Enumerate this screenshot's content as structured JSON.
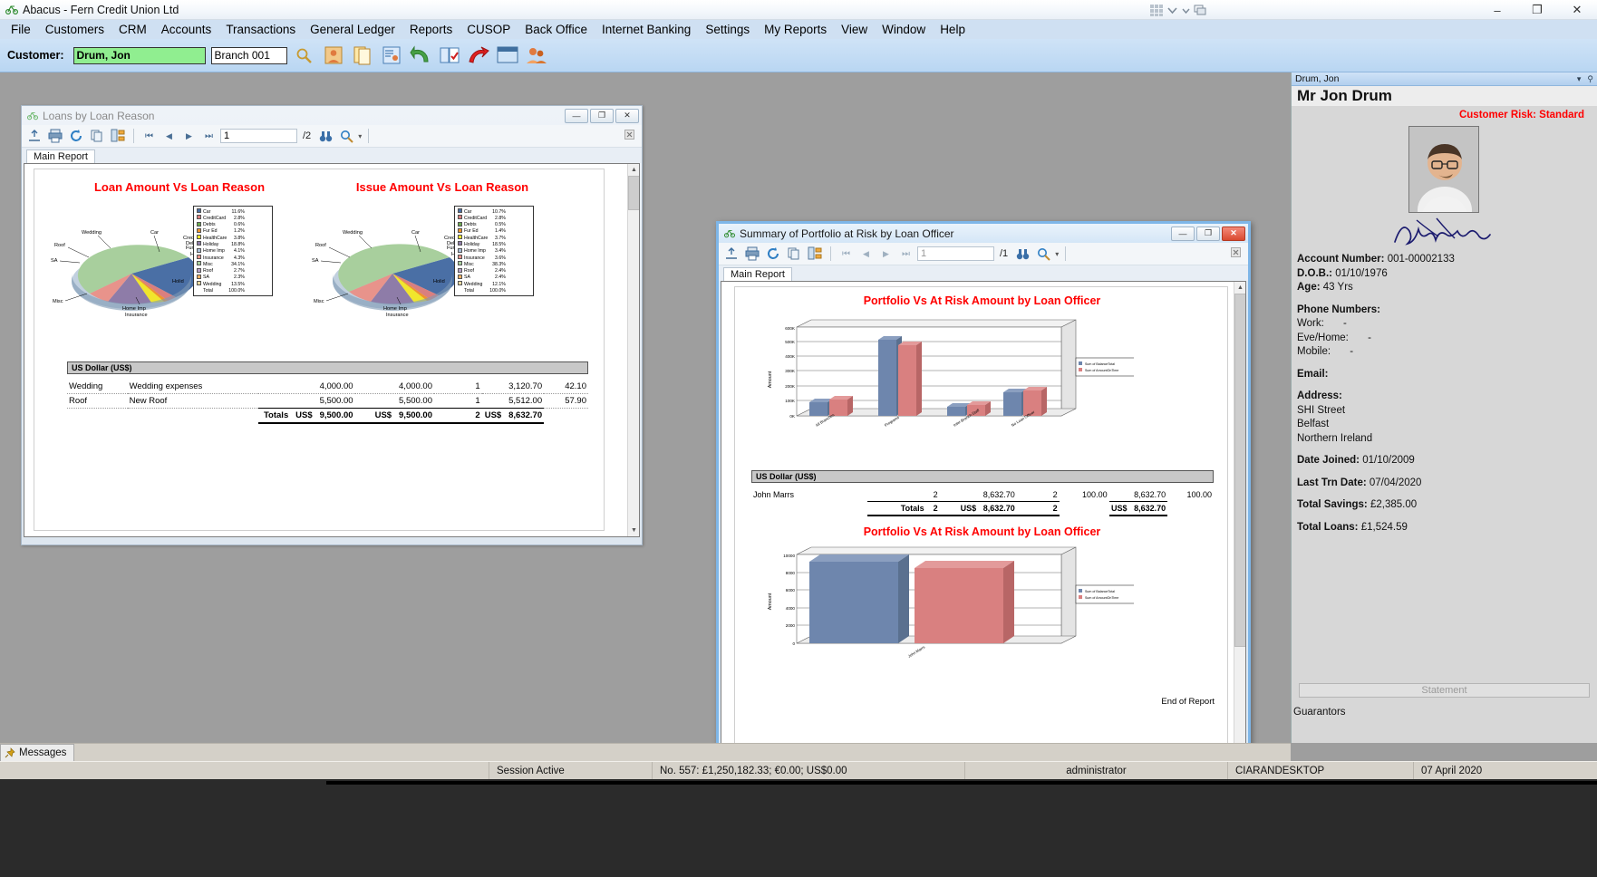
{
  "app": {
    "title": "Abacus - Fern Credit Union Ltd",
    "icon": "abacus-icon",
    "window_controls": {
      "minimize": "–",
      "maximize": "❐",
      "close": "✕"
    }
  },
  "menubar": {
    "items": [
      "File",
      "Customers",
      "CRM",
      "Accounts",
      "Transactions",
      "General Ledger",
      "Reports",
      "CUSOP",
      "Back Office",
      "Internet Banking",
      "Settings",
      "My Reports",
      "View",
      "Window",
      "Help"
    ]
  },
  "customer_toolbar": {
    "label": "Customer:",
    "customer_value": "Drum, Jon",
    "customer_placeholder": "Customer name",
    "branch_value": "Branch 001",
    "branch_placeholder": "Branch",
    "icons": [
      "search-icon",
      "customer-card-icon",
      "documents-icon",
      "customer-details-icon",
      "undo-arrow-icon",
      "book-check-icon",
      "red-arrow-icon",
      "window-icon",
      "people-icon"
    ]
  },
  "report_window_1": {
    "title": "Loans by Loan Reason",
    "icon": "abacus-icon",
    "active": false,
    "buttons": {
      "minimize": "—",
      "maximize": "❐",
      "close": "✕"
    },
    "toolbar": {
      "icons": [
        "export-icon",
        "print-icon",
        "refresh-icon",
        "copy-icon",
        "group-tree-icon"
      ],
      "nav": [
        "⏮",
        "◀",
        "▶",
        "⏭"
      ],
      "page_value": "1",
      "page_total": "/2",
      "find_icon": "binoculars-icon",
      "zoom_icon": "zoom-icon",
      "zoom_caret": "▾"
    },
    "tab": "Main Report",
    "chart_left_title": "Loan Amount Vs Loan Reason",
    "chart_right_title": "Issue Amount Vs Loan Reason",
    "group_bar": "US Dollar (US$)",
    "table": {
      "rows": [
        {
          "reason": "Wedding",
          "desc": "Wedding expenses",
          "amount": "4,000.00",
          "issue": "4,000.00",
          "count": "1",
          "balance": "3,120.70",
          "pct": "42.10"
        },
        {
          "reason": "Roof",
          "desc": "New Roof",
          "amount": "5,500.00",
          "issue": "5,500.00",
          "count": "1",
          "balance": "5,512.00",
          "pct": "57.90"
        }
      ],
      "totals_label": "Totals",
      "cur1": "US$",
      "total1": "9,500.00",
      "cur2": "US$",
      "total2": "9,500.00",
      "total_count": "2",
      "cur3": "US$",
      "total3": "8,632.70"
    }
  },
  "report_window_2": {
    "title": "Summary of Portfolio at Risk by Loan Officer",
    "icon": "abacus-icon",
    "active": true,
    "buttons": {
      "minimize": "—",
      "maximize": "❐",
      "close": "✕"
    },
    "toolbar": {
      "icons": [
        "export-icon",
        "print-icon",
        "refresh-icon",
        "copy-icon",
        "group-tree-icon"
      ],
      "nav": [
        "⏮",
        "◀",
        "▶",
        "⏭"
      ],
      "page_value": "1",
      "page_total": "/1",
      "find_icon": "binoculars-icon",
      "zoom_icon": "zoom-icon",
      "zoom_caret": "▾"
    },
    "tab": "Main Report",
    "chart_top_title": "Portfolio Vs At Risk Amount by Loan Officer",
    "chart_bottom_title": "Portfolio Vs At Risk Amount by Loan Officer",
    "group_bar": "US Dollar (US$)",
    "table": {
      "rows": [
        {
          "officer": "John Marrs",
          "count": "2",
          "amount": "8,632.70",
          "count2": "2",
          "pct": "100.00",
          "amount2": "8,632.70",
          "pct2": "100.00"
        }
      ],
      "totals_label": "Totals",
      "total_count": "2",
      "cur1": "US$",
      "total1": "8,632.70",
      "total_count2": "2",
      "cur2": "US$",
      "total2": "8,632.70"
    },
    "end_of_report": "End of Report"
  },
  "chart_data": [
    {
      "type": "pie",
      "title": "Loan Amount Vs Loan Reason",
      "legend_position": "right",
      "categories": [
        "Car",
        "CreditCard",
        "Debts",
        "Fur Ed",
        "HealthCare",
        "Holiday",
        "Home Imp",
        "Insurance",
        "Misc",
        "Roof",
        "SA",
        "Wedding"
      ],
      "values": [
        11.6,
        2.8,
        0.6,
        1.2,
        3.8,
        18.8,
        4.1,
        4.3,
        34.1,
        2.7,
        2.3,
        13.5
      ],
      "value_labels": [
        "11.6%",
        "2.8%",
        "0.6%",
        "1.2%",
        "3.8%",
        "18.8%",
        "4.1%",
        "4.3%",
        "34.1%",
        "2.7%",
        "2.3%",
        "13.5%"
      ],
      "total_label": "Total",
      "total_value": "100.0%",
      "colors": [
        "#4a6fa5",
        "#d97f7f",
        "#6aa84f",
        "#f0932b",
        "#f1e62c",
        "#8e7ca8",
        "#a9bed8",
        "#e8938b",
        "#a8cf9d",
        "#b7a0c9",
        "#f0b060",
        "#e8d8a0"
      ],
      "slice_callouts": [
        "Wedding",
        "Car",
        "CreditCard",
        "Fur Ed",
        "HealthCare",
        "Holiday",
        "Home Imp",
        "Insurance",
        "Misc",
        "SA",
        "Roof"
      ]
    },
    {
      "type": "pie",
      "title": "Issue Amount Vs Loan Reason",
      "legend_position": "right",
      "categories": [
        "Car",
        "CreditCard",
        "Debts",
        "Fur Ed",
        "HealthCare",
        "Holiday",
        "Home Imp",
        "Insurance",
        "Misc",
        "Roof",
        "SA",
        "Wedding"
      ],
      "values": [
        10.7,
        2.8,
        0.5,
        1.4,
        3.7,
        18.5,
        3.4,
        3.6,
        38.3,
        2.4,
        2.4,
        12.1
      ],
      "value_labels": [
        "10.7%",
        "2.8%",
        "0.5%",
        "1.4%",
        "3.7%",
        "18.5%",
        "3.4%",
        "3.6%",
        "38.3%",
        "2.4%",
        "2.4%",
        "12.1%"
      ],
      "total_label": "Total",
      "total_value": "100.0%",
      "colors": [
        "#4a6fa5",
        "#d97f7f",
        "#6aa84f",
        "#f0932b",
        "#f1e62c",
        "#8e7ca8",
        "#a9bed8",
        "#e8938b",
        "#a8cf9d",
        "#b7a0c9",
        "#f0b060",
        "#e8d8a0"
      ],
      "slice_callouts": [
        "Wedding",
        "Car",
        "CreditCard",
        "Fur Ed",
        "HealthCare",
        "Holiday",
        "Home Imp",
        "Insurance",
        "Misc",
        "SA",
        "Roof"
      ]
    },
    {
      "type": "bar",
      "title": "Portfolio Vs At Risk Amount by Loan Officer",
      "ylabel": "Amount",
      "xlabel": "",
      "categories": [
        "All Branches",
        "Programs",
        "Inter-Branch Staff",
        "No Loan Officer"
      ],
      "ytick_labels": [
        "0K",
        "100K",
        "200K",
        "300K",
        "400K",
        "500K",
        "600K"
      ],
      "ylim": [
        0,
        600000
      ],
      "series": [
        {
          "name": "Sum of BalanceTotal",
          "values": [
            90000,
            520000,
            60000,
            160000
          ],
          "color": "#6e86ad"
        },
        {
          "name": "Sum of AmountOnTime",
          "values": [
            105000,
            480000,
            75000,
            170000
          ],
          "color": "#d98080"
        }
      ],
      "legend_position": "right",
      "grid": true
    },
    {
      "type": "bar",
      "title": "Portfolio Vs At Risk Amount by Loan Officer",
      "ylabel": "Amount",
      "xlabel": "",
      "categories": [
        "John Marrs"
      ],
      "ytick_labels": [
        "0",
        "2000",
        "4000",
        "6000",
        "8000",
        "10000"
      ],
      "ylim": [
        0,
        10000
      ],
      "series": [
        {
          "name": "Sum of BalanceTotal",
          "values": [
            9500
          ],
          "color": "#6e86ad"
        },
        {
          "name": "Sum of AmountOnTime",
          "values": [
            8632
          ],
          "color": "#d98080"
        }
      ],
      "legend_position": "right",
      "grid": true
    }
  ],
  "sidebar": {
    "header_name": "Drum, Jon",
    "header_caret": "▾",
    "header_pin": "⚲",
    "display_name": "Mr Jon Drum",
    "risk": "Customer Risk: Standard",
    "photo": "customer-photo",
    "signature": "customer-signature",
    "account_number_label": "Account Number:",
    "account_number": "001-00002133",
    "dob_label": "D.O.B.:",
    "dob": "01/10/1976",
    "age_label": "Age:",
    "age": "43 Yrs",
    "phone_heading": "Phone Numbers:",
    "phone_work_label": "Work:",
    "phone_work": "-",
    "phone_eve_label": "Eve/Home:",
    "phone_eve": "-",
    "phone_mobile_label": "Mobile:",
    "phone_mobile": "-",
    "email_label": "Email:",
    "email": "",
    "address_label": "Address:",
    "address_lines": [
      "SHI Street",
      "Belfast",
      "Northern Ireland"
    ],
    "date_joined_label": "Date Joined:",
    "date_joined": "01/10/2009",
    "last_trn_label": "Last Trn Date:",
    "last_trn": "07/04/2020",
    "total_savings_label": "Total Savings:",
    "total_savings": "£2,385.00",
    "total_loans_label": "Total Loans:",
    "total_loans": "£1,524.59",
    "statement_button": "Statement",
    "guarantors": "Guarantors"
  },
  "messages_bar": {
    "tab": "Messages",
    "icon": "pin-icon"
  },
  "statusbar": {
    "session": "Session Active",
    "totals": "No. 557: £1,250,182.33; €0.00; US$0.00",
    "user": "administrator",
    "machine": "CIARANDESKTOP",
    "date": "07 April 2020"
  }
}
